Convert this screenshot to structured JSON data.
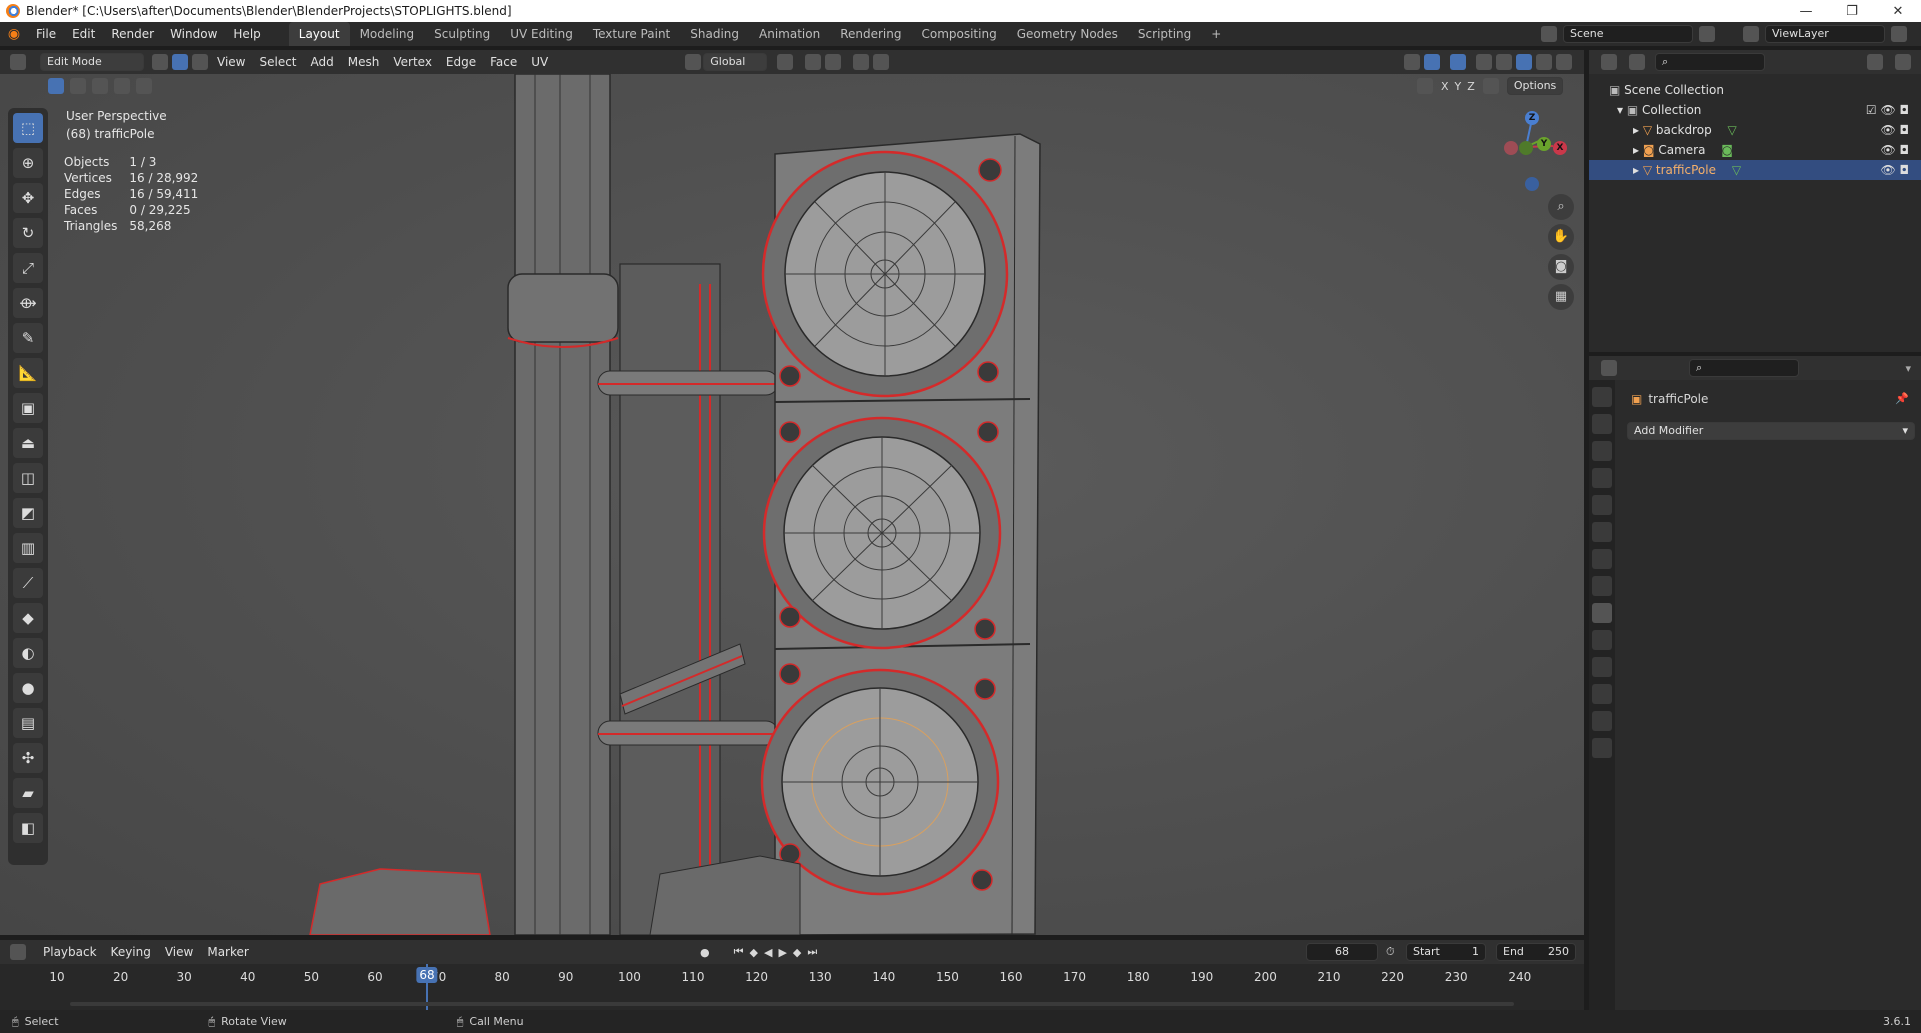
{
  "window": {
    "title": "Blender* [C:\\Users\\after\\Documents\\Blender\\BlenderProjects\\STOPLIGHTS.blend]",
    "controls": [
      "—",
      "❐",
      "✕"
    ]
  },
  "menubar": {
    "items": [
      "File",
      "Edit",
      "Render",
      "Window",
      "Help"
    ],
    "workspaces": [
      "Layout",
      "Modeling",
      "Sculpting",
      "UV Editing",
      "Texture Paint",
      "Shading",
      "Animation",
      "Rendering",
      "Compositing",
      "Geometry Nodes",
      "Scripting",
      "+"
    ],
    "active_workspace": "Layout",
    "scene": "Scene",
    "view_layer": "ViewLayer"
  },
  "viewport_header": {
    "mode": "Edit Mode",
    "menus": [
      "View",
      "Select",
      "Add",
      "Mesh",
      "Vertex",
      "Edge",
      "Face",
      "UV"
    ],
    "transform_orientation": "Global",
    "axes": [
      "X",
      "Y",
      "Z"
    ],
    "options": "Options"
  },
  "viewport": {
    "view_name": "User Perspective",
    "object_label": "(68) trafficPole",
    "stats": [
      {
        "label": "Objects",
        "value": "1 / 3"
      },
      {
        "label": "Vertices",
        "value": "16 / 28,992"
      },
      {
        "label": "Edges",
        "value": "16 / 59,411"
      },
      {
        "label": "Faces",
        "value": "0 / 29,225"
      },
      {
        "label": "Triangles",
        "value": "58,268"
      }
    ],
    "gizmo": {
      "z": "Z",
      "y": "Y",
      "x": "X"
    }
  },
  "outliner": {
    "root": "Scene Collection",
    "collection": "Collection",
    "items": [
      {
        "name": "backdrop",
        "selected": false
      },
      {
        "name": "Camera",
        "selected": false
      },
      {
        "name": "trafficPole",
        "selected": true
      }
    ]
  },
  "properties": {
    "object_name": "trafficPole",
    "add_modifier": "Add Modifier"
  },
  "timeline": {
    "menus": [
      "Playback",
      "Keying",
      "View",
      "Marker"
    ],
    "current_frame": "68",
    "start_label": "Start",
    "start": "1",
    "end_label": "End",
    "end": "250",
    "ticks": [
      "10",
      "20",
      "30",
      "40",
      "50",
      "60",
      "70",
      "80",
      "90",
      "100",
      "110",
      "120",
      "130",
      "140",
      "150",
      "160",
      "170",
      "180",
      "190",
      "200",
      "210",
      "220",
      "230",
      "240"
    ],
    "playhead": "68"
  },
  "statusbar": {
    "select": "Select",
    "rotate": "Rotate View",
    "call_menu": "Call Menu",
    "version": "3.6.1"
  },
  "colors": {
    "accent": "#4772b3",
    "edge_seam": "#d42a2a",
    "selected_row": "#334d80"
  }
}
